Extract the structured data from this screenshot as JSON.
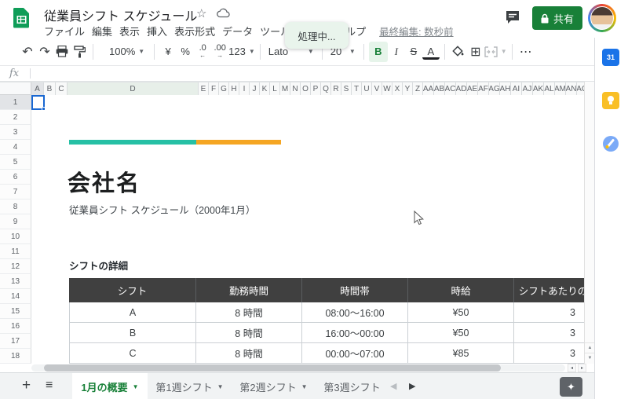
{
  "app": {
    "title": "従業員シフト スケジュール",
    "menu": [
      "ファイル",
      "編集",
      "表示",
      "挿入",
      "表示形式",
      "データ",
      "ツール",
      "ヘルプ"
    ],
    "last_edit": "最終編集: 数秒前",
    "toast": "処理中...",
    "share": "共有"
  },
  "toolbar": {
    "zoom": "100%",
    "currency": "¥",
    "percent": "%",
    "decimal_decrease": ".0",
    "decimal_increase": ".00",
    "more_formats": "123",
    "font": "Lato",
    "font_size": "20",
    "bold": "B",
    "italic": "I",
    "strikethrough": "S",
    "text_color": "A",
    "more": "⋯"
  },
  "formula_bar": {
    "fx": "fx",
    "value": ""
  },
  "grid": {
    "columns": [
      "A",
      "B",
      "C",
      "D",
      "E",
      "F",
      "G",
      "H",
      "I",
      "J",
      "K",
      "L",
      "M",
      "N",
      "O",
      "P",
      "Q",
      "R",
      "S",
      "T",
      "U",
      "V",
      "W",
      "X",
      "Y",
      "Z",
      "AA",
      "AB",
      "AC",
      "AD",
      "AE",
      "AF",
      "AG",
      "AH",
      "AI",
      "AJ",
      "AK",
      "AL",
      "AM",
      "AN",
      "AO"
    ],
    "rows": [
      "1",
      "2",
      "3",
      "4",
      "5",
      "6",
      "7",
      "8",
      "9",
      "10",
      "11",
      "12",
      "13",
      "14",
      "15",
      "16",
      "17",
      "18"
    ],
    "selection": {
      "column": "A",
      "row": "1"
    }
  },
  "sheet": {
    "company": "会社名",
    "subtitle": "従業員シフト スケジュール（2000年1月）",
    "section": "シフトの詳細",
    "table": {
      "headers": [
        "シフト",
        "勤務時間",
        "時間帯",
        "時給",
        "シフトあたりの従業員数"
      ],
      "rows": [
        [
          "A",
          "8 時間",
          "08:00～16:00",
          "¥50",
          "3"
        ],
        [
          "B",
          "8 時間",
          "16:00～00:00",
          "¥50",
          "3"
        ],
        [
          "C",
          "8 時間",
          "00:00～07:00",
          "¥85",
          "3"
        ]
      ]
    },
    "accent_teal": "#26c0a5",
    "accent_orange": "#f5a623"
  },
  "tabs": {
    "add": "+",
    "items": [
      "1月の概要",
      "第1週シフト",
      "第2週シフト",
      "第3週シフト"
    ],
    "active": "1月の概要"
  },
  "side_panel": {
    "icons": [
      "calendar-icon",
      "keep-icon",
      "tasks-icon"
    ]
  },
  "colors": {
    "logo_green": "#0f9d58",
    "share_button": "#188038",
    "active_tab_text": "#188038",
    "table_header_bg": "#404040",
    "toast_bg": "#e9f4ec"
  }
}
